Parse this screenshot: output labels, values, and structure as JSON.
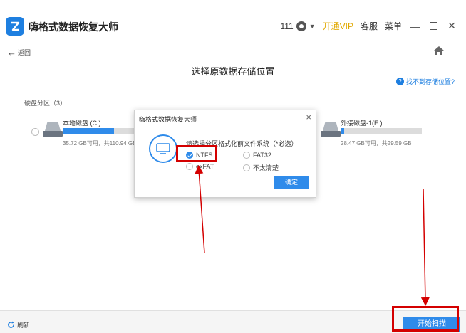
{
  "app": {
    "title": "嗨格式数据恢复大师"
  },
  "titlebar": {
    "user": "111",
    "vip": "开通VIP",
    "service": "客服",
    "menu": "菜单"
  },
  "nav": {
    "back": "返回"
  },
  "page": {
    "title": "选择原数据存储位置",
    "help": "找不到存储位置?"
  },
  "partitions": {
    "header": "硬盘分区（3）",
    "items": [
      {
        "name": "本地磁盘 (C:)",
        "size": "35.72 GB可用，共110.94 GB",
        "used_fraction": 0.68
      },
      {
        "name": "外接磁盘-1(E:)",
        "size": "28.47 GB可用，共29.59 GB",
        "used_fraction": 0.04
      }
    ]
  },
  "dialog": {
    "title": "嗨格式数据恢复大师",
    "prompt": "请选择分区格式化前文件系统（*必选）",
    "options": [
      {
        "label": "NTFS",
        "selected": true
      },
      {
        "label": "FAT32",
        "selected": false
      },
      {
        "label": "exFAT",
        "selected": false
      },
      {
        "label": "不太清楚",
        "selected": false
      }
    ],
    "confirm": "确定"
  },
  "footer": {
    "refresh": "刷新",
    "start": "开始扫描"
  },
  "colors": {
    "accent": "#2f8bea",
    "vip": "#e0a800",
    "annotation": "#d40000"
  }
}
